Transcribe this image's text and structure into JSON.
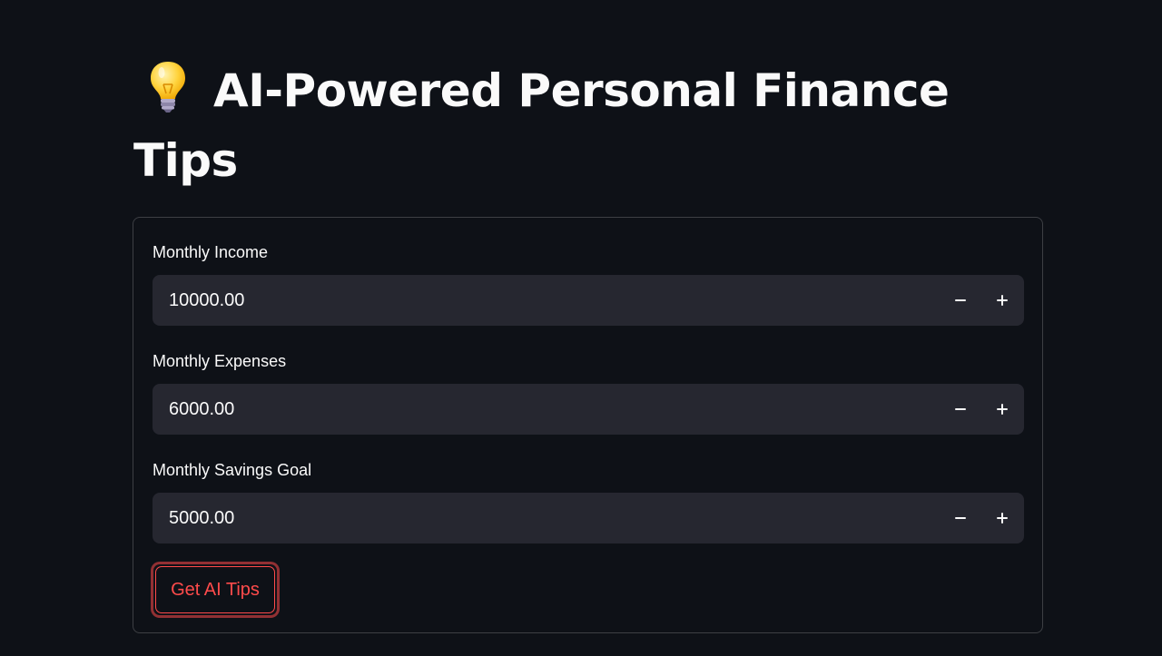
{
  "title": {
    "icon": "light-bulb-icon",
    "text": "AI-Powered Personal Finance Tips"
  },
  "form": {
    "fields": [
      {
        "label": "Monthly Income",
        "value": "10000.00"
      },
      {
        "label": "Monthly Expenses",
        "value": "6000.00"
      },
      {
        "label": "Monthly Savings Goal",
        "value": "5000.00"
      }
    ],
    "submit_label": "Get AI Tips"
  },
  "colors": {
    "background": "#0e1117",
    "input_background": "#262730",
    "accent": "#ff4b4b",
    "text": "#fafafa"
  }
}
